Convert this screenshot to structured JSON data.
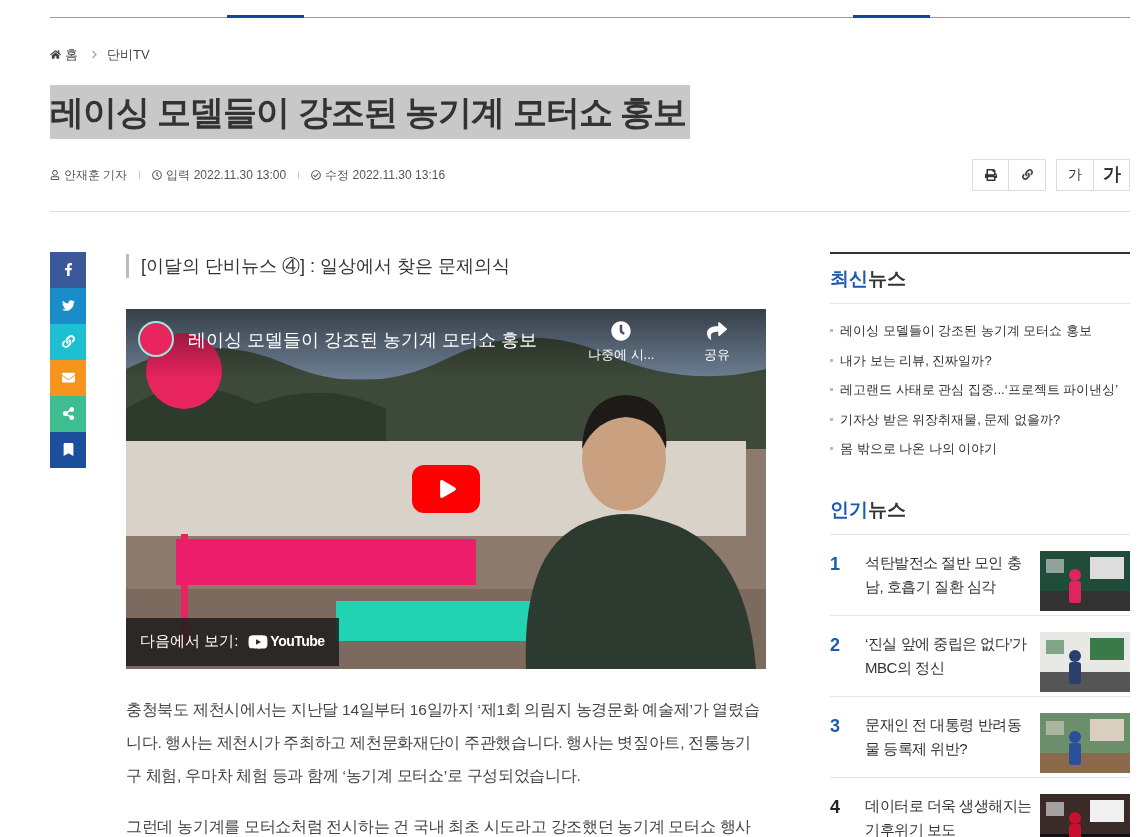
{
  "breadcrumb": [
    {
      "label": "홈",
      "kind": "home"
    },
    {
      "label": "단비TV",
      "kind": "section"
    }
  ],
  "title": "레이싱 모델들이 강조된 농기계 모터쇼 홍보",
  "byline": {
    "author": "안재훈 기자",
    "published": "입력 2022.11.30 13:00",
    "modified": "수정 2022.11.30 13:16"
  },
  "font_buttons": [
    {
      "label": "가",
      "kind": "smaller"
    },
    {
      "label": "가",
      "kind": "larger"
    }
  ],
  "share_buttons": [
    {
      "kind": "facebook",
      "color": "#3b5998"
    },
    {
      "kind": "twitter",
      "color": "#1a8cc8"
    },
    {
      "kind": "link",
      "color": "#1ebfd0"
    },
    {
      "kind": "mail",
      "color": "#f7941d"
    },
    {
      "kind": "share",
      "color": "#3ebd91"
    },
    {
      "kind": "bookmark",
      "color": "#1b4f9c"
    }
  ],
  "subtitle": "[이달의 단비뉴스 ④] : 일상에서 찾은 문제의식",
  "video": {
    "title": "레이싱 모델들이 강조된 농기계 모터쇼 홍보",
    "watch_later": "나중에 시...",
    "share": "공유",
    "watch_on": "다음에서 보기:",
    "logo": "YouTube"
  },
  "paragraphs": [
    "충청북도 제천시에서는 지난달 14일부터 16일까지 ‘제1회 의림지 농경문화 예술제’가 열렸습니다. 행사는 제천시가 주최하고 제천문화재단이 주관했습니다. 행사는 볏짚아트, 전통농기구 체험, 우마차 체험 등과 함께 ‘농기계 모터쇼’로 구성되었습니다.",
    "그런데 농기계를 모터쇼처럼 전시하는 건 국내 최초 시도라고 강조했던 농기계 모터쇼 행사"
  ],
  "latest": {
    "heading_accent": "최신",
    "heading_rest": "뉴스",
    "items": [
      "레이싱 모델들이 강조된 농기계 모터쇼 홍보",
      "내가 보는 리뷰, 진짜일까?",
      "레고랜드 사태로 관심 집중...‘프로젝트 파이낸싱’",
      "기자상 받은 위장취재물, 문제 없을까?",
      "몸 밖으로 나온 나의 이야기"
    ]
  },
  "popular": {
    "heading_accent": "인기",
    "heading_rest": "뉴스",
    "items": [
      {
        "rank": "1",
        "title": "석탄발전소 절반 모인 충남, 호흡기 질환 심각",
        "color": "#1a5bb5",
        "kind": "picture"
      },
      {
        "rank": "2",
        "title": "‘진실 앞에 중립은 없다’가 MBC의 정신",
        "color": "#1a5bb5",
        "kind": "picture"
      },
      {
        "rank": "3",
        "title": "문재인 전 대통령 반려동물 등록제 위반?",
        "color": "#1a5bb5",
        "kind": "picture"
      },
      {
        "rank": "4",
        "title": "데이터로 더욱 생생해지는 기후위기 보도",
        "color": "#222222",
        "kind": "picture"
      }
    ]
  }
}
